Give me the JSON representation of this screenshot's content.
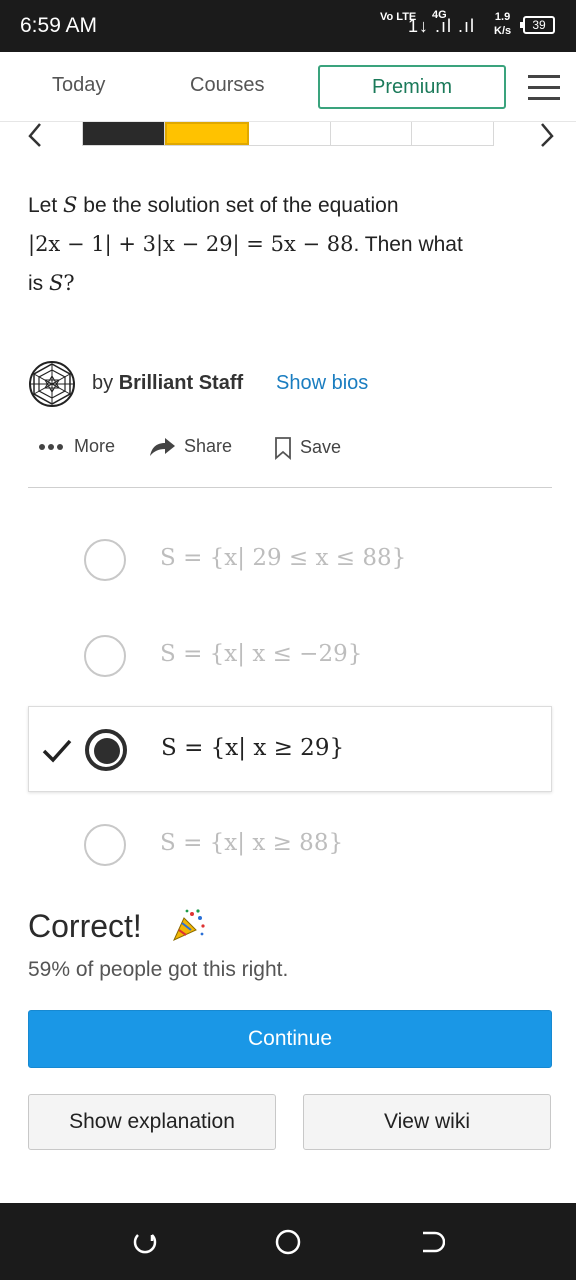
{
  "status_bar": {
    "time": "6:59 AM",
    "volte": "Vo LTE",
    "network": "4G",
    "sim": "1",
    "speed_value": "1.9",
    "speed_unit": "K/s",
    "battery": "39"
  },
  "top_nav": {
    "today_label": "Today",
    "courses_label": "Courses",
    "premium_label": "Premium"
  },
  "progress": {
    "segments_total": 5,
    "done": 1,
    "current_index": 1,
    "colors": {
      "done": "#2a2a2a",
      "current": "#ffc200"
    }
  },
  "question": {
    "prefix": "Let",
    "var_s": "S",
    "text_1": "be the solution set of the equation",
    "equation": "|2x − 1| + 3|x − 29| = 5x − 88",
    "text_2": ". Then what",
    "text_3": "is",
    "var_s2": "S",
    "qmark": "?"
  },
  "author": {
    "by_prefix": "by",
    "name": "Brilliant Staff",
    "bios_link": "Show bios"
  },
  "actions": {
    "more_label": "More",
    "share_label": "Share",
    "save_label": "Save"
  },
  "options": [
    {
      "text": "S = {x| 29 ≤ x ≤ 88}",
      "selected": false
    },
    {
      "text": "S = {x| x ≤ −29}",
      "selected": false
    },
    {
      "text": "S = {x| x ≥ 29}",
      "selected": true
    },
    {
      "text": "S = {x| x ≥ 88}",
      "selected": false
    }
  ],
  "result": {
    "title": "Correct!",
    "stat": "59% of people got this right."
  },
  "buttons": {
    "continue_label": "Continue",
    "explanation_label": "Show explanation",
    "wiki_label": "View wiki"
  },
  "colors": {
    "accent_blue": "#1a97e6",
    "premium_green": "#3aa37d",
    "link_blue": "#1a7dc0"
  },
  "icons": {
    "menu": "hamburger-icon",
    "back_nav": "chevron-left-icon",
    "forward_nav": "chevron-right-icon",
    "share": "share-arrow-icon",
    "save": "bookmark-icon",
    "more": "dots-icon",
    "check": "checkmark-icon",
    "party": "party-popper-icon",
    "author_logo": "geodesic-sphere-icon"
  }
}
